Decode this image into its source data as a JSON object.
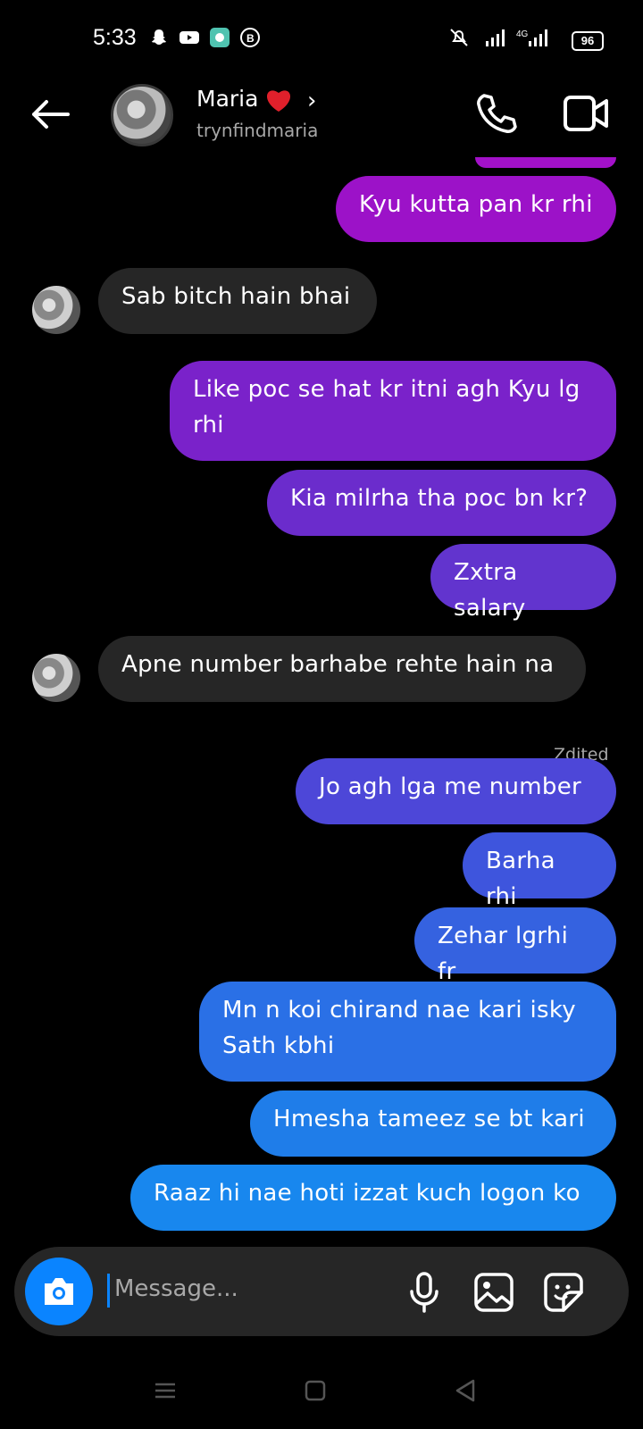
{
  "status_bar": {
    "time": "5:33",
    "battery": "96",
    "network": "4G"
  },
  "header": {
    "name": "Maria",
    "username": "trynfindmaria"
  },
  "messages": [
    {
      "text": "Kyu kutta pan kr rhi",
      "dir": "out"
    },
    {
      "text": "Sab bitch hain bhai",
      "dir": "in"
    },
    {
      "text": "Like poc se hat kr itni agh Kyu lg rhi",
      "dir": "out"
    },
    {
      "text": "Kia milrha tha poc bn kr?",
      "dir": "out"
    },
    {
      "text": "Zxtra salary",
      "dir": "out"
    },
    {
      "text": "Apne number barhabe rehte hain na",
      "dir": "in"
    },
    {
      "text": "Jo agh lga me number",
      "dir": "out"
    },
    {
      "text": "Barha rhi",
      "dir": "out"
    },
    {
      "text": "Zehar lgrhi fr",
      "dir": "out"
    },
    {
      "text": "Mn n koi chirand nae kari isky Sath kbhi",
      "dir": "out"
    },
    {
      "text": "Hmesha tameez se bt kari",
      "dir": "out"
    },
    {
      "text": "Raaz hi nae hoti izzat kuch logon ko",
      "dir": "out"
    }
  ],
  "edited_label": "Zdited",
  "composer": {
    "placeholder": "Message..."
  },
  "colors": {
    "incoming": "#262626",
    "accent_blue": "#0a84ff"
  }
}
